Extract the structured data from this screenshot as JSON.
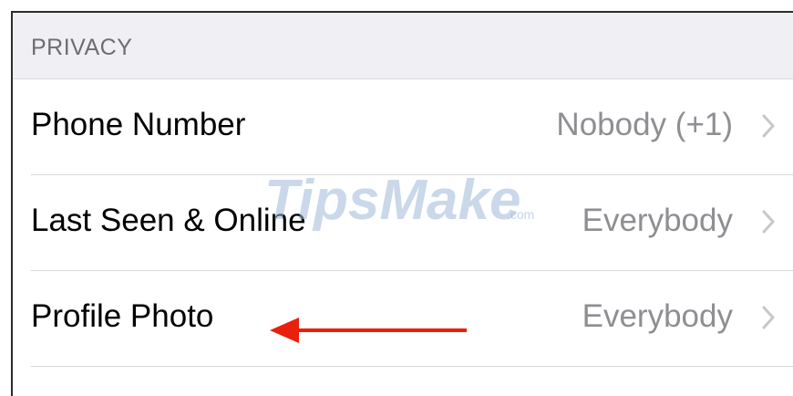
{
  "privacy": {
    "header": "PRIVACY",
    "items": [
      {
        "label": "Phone Number",
        "value": "Nobody (+1)"
      },
      {
        "label": "Last Seen & Online",
        "value": "Everybody"
      },
      {
        "label": "Profile Photo",
        "value": "Everybody"
      }
    ]
  },
  "watermark": {
    "text": "TipsMake",
    "suffix": ".com"
  },
  "colors": {
    "header_bg": "#efeff4",
    "value_gray": "#8e8e93",
    "arrow_red": "#e8200c",
    "watermark_blue": "#9fb8d8"
  },
  "icons": [
    "chevron-right-icon",
    "left-arrow-annotation"
  ]
}
